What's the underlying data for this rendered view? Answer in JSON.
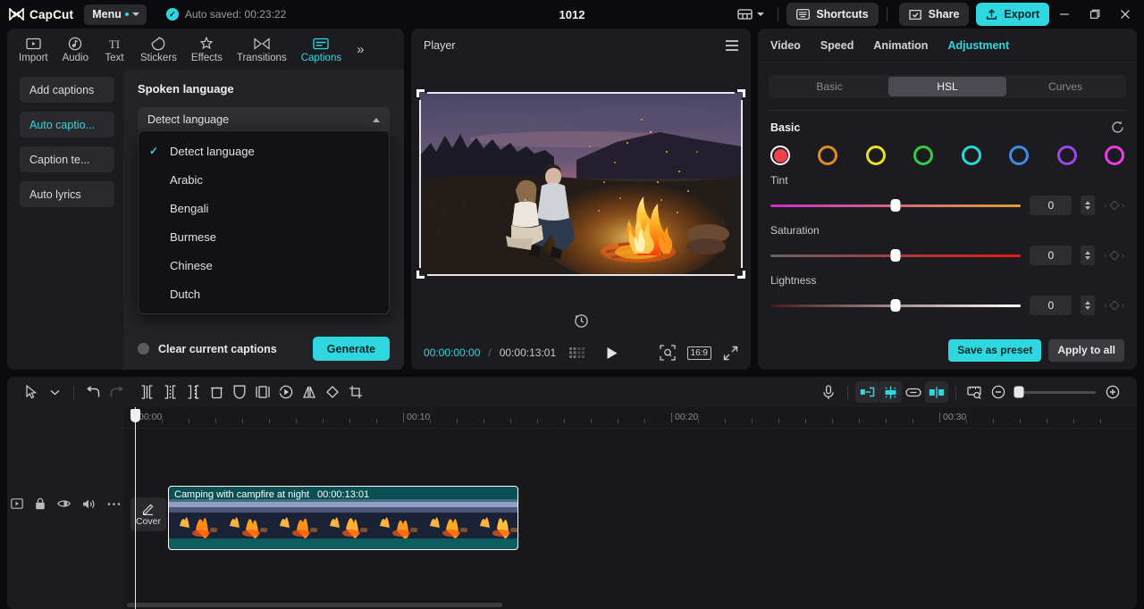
{
  "titlebar": {
    "app_name": "CapCut",
    "menu_label": "Menu",
    "autosave": "Auto saved: 00:23:22",
    "project_title": "1012",
    "shortcuts": "Shortcuts",
    "share": "Share",
    "export": "Export",
    "icons": {
      "layout": "layout-icon",
      "minimize": "minimize-icon",
      "maximize": "maximize-icon",
      "close": "close-icon"
    }
  },
  "left_panel": {
    "tabs": [
      {
        "label": "Import",
        "icon": "import-icon",
        "active": false
      },
      {
        "label": "Audio",
        "icon": "audio-icon",
        "active": false
      },
      {
        "label": "Text",
        "icon": "text-icon",
        "active": false
      },
      {
        "label": "Stickers",
        "icon": "stickers-icon",
        "active": false
      },
      {
        "label": "Effects",
        "icon": "effects-icon",
        "active": false
      },
      {
        "label": "Transitions",
        "icon": "transitions-icon",
        "active": false
      },
      {
        "label": "Captions",
        "icon": "captions-icon",
        "active": true
      }
    ],
    "more_label": "»",
    "side_buttons": [
      {
        "label": "Add captions",
        "active": false
      },
      {
        "label": "Auto captio...",
        "active": true
      },
      {
        "label": "Caption te...",
        "active": false
      },
      {
        "label": "Auto lyrics",
        "active": false
      }
    ],
    "section_title": "Spoken language",
    "select_value": "Detect language",
    "dropdown_options": [
      {
        "label": "Detect language",
        "checked": true
      },
      {
        "label": "Arabic",
        "checked": false
      },
      {
        "label": "Bengali",
        "checked": false
      },
      {
        "label": "Burmese",
        "checked": false
      },
      {
        "label": "Chinese",
        "checked": false
      },
      {
        "label": "Dutch",
        "checked": false
      }
    ],
    "footer": {
      "clear_label": "Clear current captions",
      "generate_label": "Generate"
    }
  },
  "player": {
    "title": "Player",
    "current_time": "00:00:00:00",
    "separator": "/",
    "total_time": "00:00:13:01",
    "ratio": "16:9",
    "icons": {
      "menu": "hamburger-icon",
      "refresh": "refresh-icon",
      "quality": "quality-icon",
      "play": "play-icon",
      "zoom_fit": "zoom-fit-icon",
      "fullscreen": "fullscreen-icon"
    }
  },
  "right_panel": {
    "tabs": [
      {
        "label": "Video",
        "active": false
      },
      {
        "label": "Speed",
        "active": false
      },
      {
        "label": "Animation",
        "active": false
      },
      {
        "label": "Adjustment",
        "active": true
      }
    ],
    "segments": [
      {
        "label": "Basic",
        "active": false
      },
      {
        "label": "HSL",
        "active": true
      },
      {
        "label": "Curves",
        "active": false
      }
    ],
    "section_title": "Basic",
    "reset_icon": "reset-icon",
    "swatches": [
      {
        "name": "red",
        "color": "#f0424b",
        "selected": true
      },
      {
        "name": "orange",
        "color": "#e08a28",
        "selected": false
      },
      {
        "name": "yellow",
        "color": "#e8e024",
        "selected": false
      },
      {
        "name": "green",
        "color": "#35cc44",
        "selected": false
      },
      {
        "name": "cyan",
        "color": "#28d8d8",
        "selected": false
      },
      {
        "name": "blue",
        "color": "#3c8ce8",
        "selected": false
      },
      {
        "name": "purple",
        "color": "#9a48e8",
        "selected": false
      },
      {
        "name": "magenta",
        "color": "#ee3ce0",
        "selected": false
      }
    ],
    "sliders": [
      {
        "label": "Tint",
        "value": "0",
        "pct": 50,
        "from": "#cc2ecc",
        "to": "#e0a030"
      },
      {
        "label": "Saturation",
        "value": "0",
        "pct": 50,
        "from": "#6a6262",
        "to": "#e81818"
      },
      {
        "label": "Lightness",
        "value": "0",
        "pct": 50,
        "from": "#4a1a1a",
        "to": "#ffffff"
      }
    ],
    "save_preset": "Save as preset",
    "apply_all": "Apply to all"
  },
  "timeline": {
    "tools_left": [
      {
        "name": "select-tool-icon",
        "state": "normal"
      },
      {
        "name": "select-dropdown-icon",
        "state": "normal"
      },
      {
        "name": "undo-icon",
        "state": "normal"
      },
      {
        "name": "redo-icon",
        "state": "disabled"
      },
      {
        "name": "split-icon",
        "state": "normal"
      },
      {
        "name": "trim-left-icon",
        "state": "normal"
      },
      {
        "name": "trim-right-icon",
        "state": "normal"
      },
      {
        "name": "delete-icon",
        "state": "normal"
      },
      {
        "name": "mask-icon",
        "state": "normal"
      },
      {
        "name": "crop-frame-icon",
        "state": "normal"
      },
      {
        "name": "freeze-icon",
        "state": "normal"
      },
      {
        "name": "mirror-icon",
        "state": "normal"
      },
      {
        "name": "rotate-icon",
        "state": "normal"
      },
      {
        "name": "crop-icon",
        "state": "normal"
      }
    ],
    "tools_right": [
      {
        "name": "mic-icon",
        "state": "normal"
      },
      {
        "name": "auto-cut-icon",
        "state": "on"
      },
      {
        "name": "magnetic-icon",
        "state": "on"
      },
      {
        "name": "link-icon",
        "state": "normal"
      },
      {
        "name": "snap-icon",
        "state": "on"
      },
      {
        "name": "preview-quality-icon",
        "state": "normal"
      },
      {
        "name": "zoom-out-icon",
        "state": "normal"
      },
      {
        "name": "zoom-in-icon",
        "state": "normal"
      }
    ],
    "ruler_labels": [
      "00:00",
      "00:10",
      "00:20",
      "00:30"
    ],
    "track_icons": [
      "track-video-icon",
      "lock-icon",
      "eye-icon",
      "volume-icon",
      "more-icon"
    ],
    "cover_label": "Cover",
    "clip": {
      "title": "Camping with campfire at night",
      "duration": "00:00:13:01"
    }
  }
}
